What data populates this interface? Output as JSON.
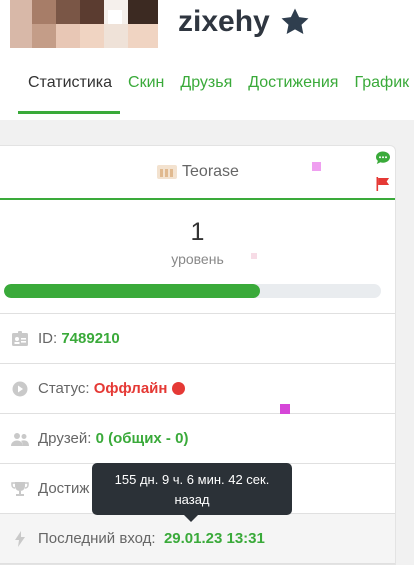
{
  "profile": {
    "username": "zixehy",
    "star_icon": "star-icon",
    "avatar_icon": "avatar"
  },
  "tabs": [
    {
      "label": "Статистика",
      "active": true
    },
    {
      "label": "Скин"
    },
    {
      "label": "Друзья"
    },
    {
      "label": "Достижения"
    },
    {
      "label": "График"
    }
  ],
  "card": {
    "server_name": "Teorase",
    "level": "1",
    "level_label": "уровень",
    "level_progress": 0.68
  },
  "stats": {
    "id_label": "ID:",
    "id_value": "7489210",
    "status_label": "Статус:",
    "status_value": "Оффлайн",
    "friends_label": "Друзей:",
    "friends_value": "0",
    "friends_common": "(общих - 0)",
    "achievements_label": "Достиж",
    "last_login_label": "Последний вход:",
    "last_login_value": "29.01.23 13:31"
  },
  "tooltip": {
    "text": "155 дн. 9 ч. 6 мин. 42 сек. назад"
  },
  "colors": {
    "accent": "#3aaa3a",
    "offline": "#e53935",
    "tooltip_bg": "#2b3137"
  }
}
